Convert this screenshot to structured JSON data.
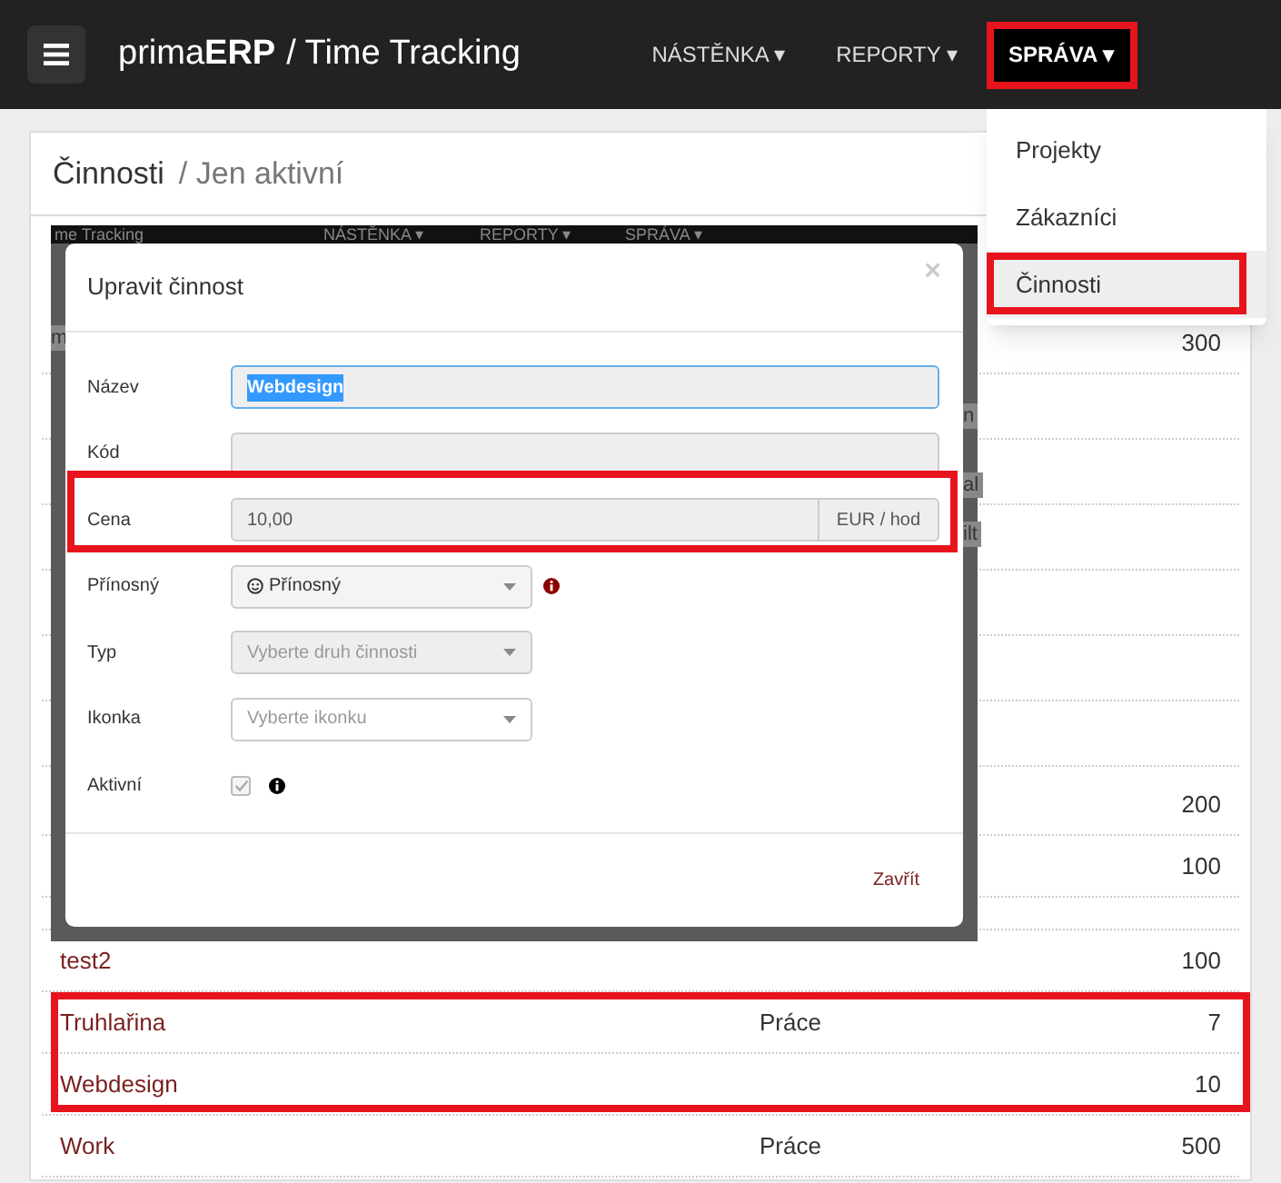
{
  "navbar": {
    "brand_light": "prima",
    "brand_bold": "ERP",
    "title": "/ Time Tracking",
    "menu": [
      {
        "label": "NÁSTĚNKA",
        "caret": "▾",
        "selected": false
      },
      {
        "label": "REPORTY",
        "caret": "▾",
        "selected": false
      },
      {
        "label": "SPRÁVA",
        "caret": "▾",
        "selected": true
      }
    ]
  },
  "dropdown": [
    {
      "label": "Projekty",
      "selected": false
    },
    {
      "label": "Zákazníci",
      "selected": false
    },
    {
      "label": "Činnosti",
      "selected": true
    }
  ],
  "breadcrumb": [
    "Činnosti",
    "/ Jen aktivní"
  ],
  "table": {
    "rows": [
      {
        "value": "300"
      },
      {
        "value": "200"
      },
      {
        "value": "100"
      },
      {
        "name": "test2",
        "value": "100"
      },
      {
        "name": "Truhlařina",
        "type": "Práce",
        "value": "7"
      },
      {
        "name": "Webdesign",
        "value": "10"
      },
      {
        "name": "Work",
        "type": "Práce",
        "value": "500"
      }
    ]
  },
  "inset": {
    "nav": [
      "me Tracking",
      "NÁSTĚNKA ▾",
      "REPORTY ▾",
      "SPRÁVA ▾"
    ],
    "fragments": [
      "m",
      "n",
      "al",
      "ilt"
    ],
    "modal": {
      "title": "Upravit činnost",
      "close": "×",
      "fields": [
        {
          "kind": "text",
          "label": "Název",
          "value": "Webdesign",
          "focused": true
        },
        {
          "kind": "text",
          "label": "Kód"
        },
        {
          "kind": "addon",
          "label": "Cena",
          "value": "10,00",
          "addon": "EUR / hod"
        },
        {
          "kind": "select",
          "label": "Přínosný",
          "value": "Přínosný",
          "info": true,
          "color": "#8b0000"
        },
        {
          "kind": "select",
          "label": "Typ",
          "placeholder": "Vyberte druh činnosti",
          "disabled": true
        },
        {
          "kind": "select",
          "label": "Ikonka",
          "placeholder": "Vyberte ikonku",
          "disabled": false
        },
        {
          "kind": "checkbox",
          "label": "Aktivní",
          "checked": true,
          "info": true,
          "color": "#000000"
        }
      ],
      "footer_button": "Zavřít"
    }
  }
}
